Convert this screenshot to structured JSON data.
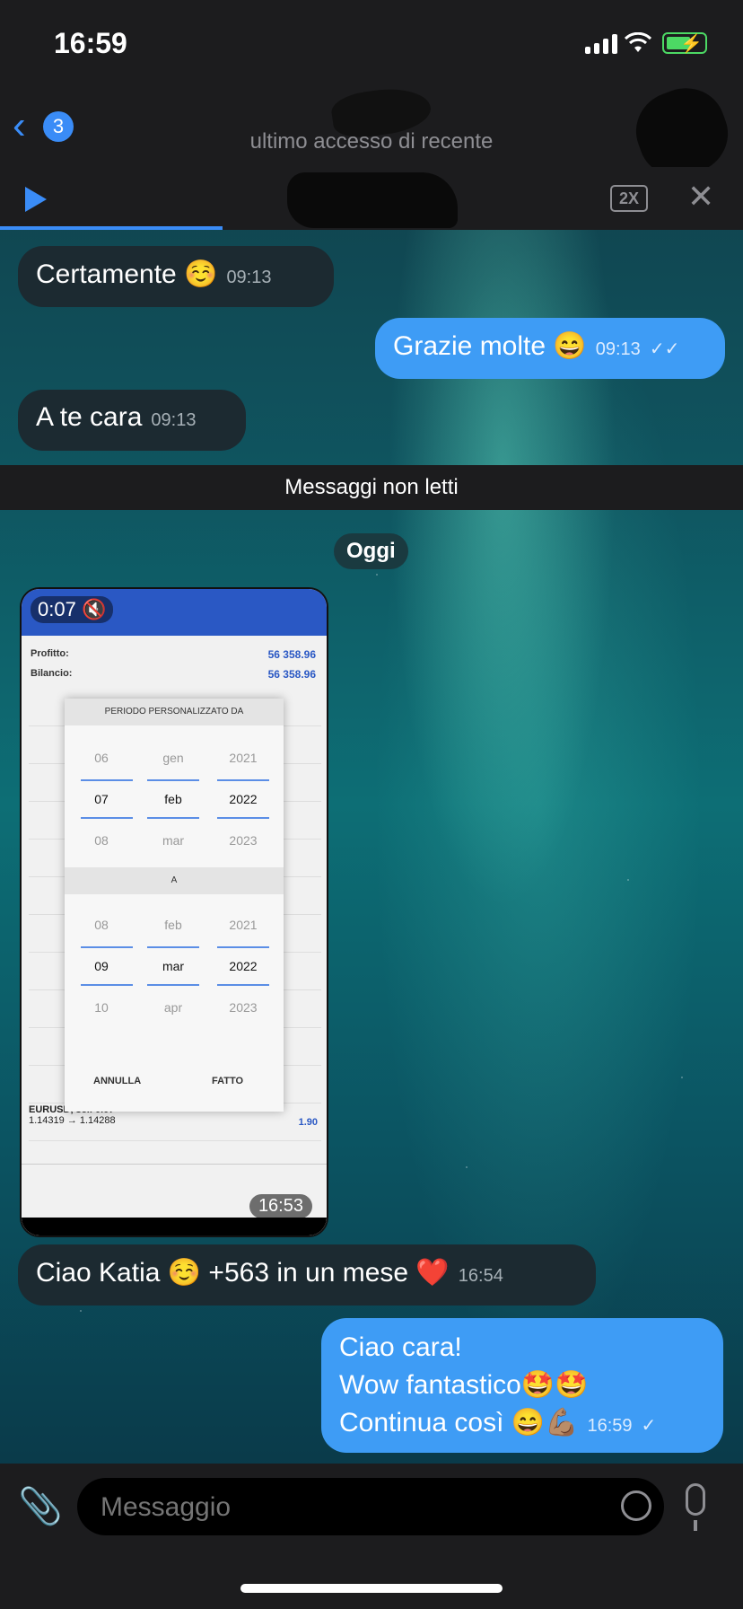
{
  "status": {
    "time": "16:59"
  },
  "header": {
    "back_badge": "3",
    "subtitle": "ultimo accesso di recente"
  },
  "audio": {
    "speed": "2X",
    "close": "✕"
  },
  "messages": [
    {
      "text": "Certamente ☺️",
      "time": "09:13"
    },
    {
      "text": "Grazie molte 😄",
      "time": "09:13"
    },
    {
      "text": "A te cara",
      "time": "09:13"
    }
  ],
  "unread_label": "Messaggi non letti",
  "day_label": "Oggi",
  "video": {
    "duration": "0:07",
    "timestamp": "16:53",
    "profit_label": "Profitto:",
    "profit_value": "56 358.96",
    "balance_label": "Bilancio:",
    "balance_value": "56 358.96",
    "modal_title_from": "PERIODO PERSONALIZZATO DA",
    "from_prev": [
      "06",
      "gen",
      "2021"
    ],
    "from_sel": [
      "07",
      "feb",
      "2022"
    ],
    "from_next": [
      "08",
      "mar",
      "2023"
    ],
    "to_title": "A",
    "to_prev": [
      "08",
      "feb",
      "2021"
    ],
    "to_sel": [
      "09",
      "mar",
      "2022"
    ],
    "to_next": [
      "10",
      "apr",
      "2023"
    ],
    "cancel": "ANNULLA",
    "done": "FATTO",
    "row1": "EURUSD, sell 0.07",
    "row1b": "1.14319 → 1.14288",
    "row1v": "1.90"
  },
  "message_4": {
    "text": "Ciao Katia ☺️ +563 in un mese ❤️",
    "time": "16:54"
  },
  "message_5": {
    "line1": "Ciao cara!",
    "line2": "Wow fantastico🤩🤩",
    "line3": "Continua così 😄💪🏽",
    "time": "16:59"
  },
  "input": {
    "placeholder": "Messaggio"
  }
}
